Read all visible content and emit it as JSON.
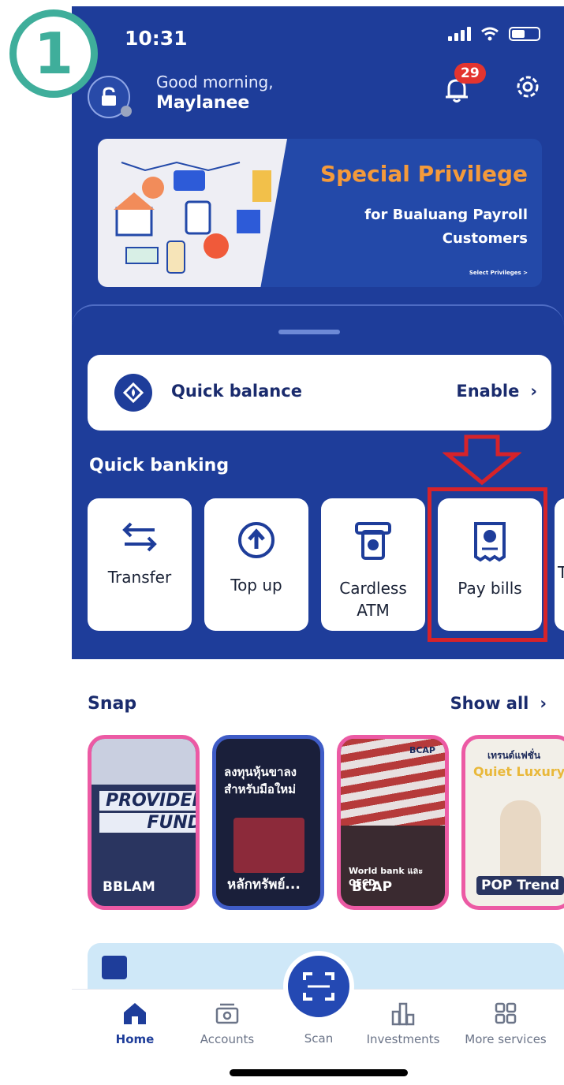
{
  "step": {
    "number": "1",
    "color": "#3fae9b"
  },
  "status_bar": {
    "time": "10:31"
  },
  "header": {
    "greeting": "Good morning,",
    "user_name": "Maylanee",
    "notification_count": "29",
    "lock_icon": "lock-icon",
    "bell_icon": "bell-icon",
    "gear_icon": "gear-icon"
  },
  "banner": {
    "title": "Special Privilege",
    "subtitle_line1": "for Bualuang Payroll",
    "subtitle_line2": "Customers",
    "link": "Select Privileges >"
  },
  "quick_balance": {
    "label": "Quick balance",
    "action": "Enable"
  },
  "quick_banking": {
    "title": "Quick banking",
    "tiles": [
      {
        "label": "Transfer",
        "icon": "transfer-icon"
      },
      {
        "label": "Top up",
        "icon": "top-up-icon"
      },
      {
        "label": "Cardless",
        "label2": "ATM",
        "icon": "atm-icon"
      },
      {
        "label": "Pay bills",
        "icon": "bill-icon"
      },
      {
        "label": "T",
        "icon": ""
      }
    ]
  },
  "snap": {
    "title": "Snap",
    "show_all": "Show all",
    "cards": [
      {
        "caption": "BBLAM",
        "headline": "PROVIDENT",
        "headline2": "FUND"
      },
      {
        "caption": "หลักทรัพย์...",
        "headline": "ลงทุนหุ้นขาลง",
        "headline2": "สำหรับมือใหม่"
      },
      {
        "caption": "BCAP",
        "headline": "BCAP",
        "headline2": "World bank และ OECD"
      },
      {
        "caption": "POP Trend",
        "headline": "เทรนด์แฟชั่น",
        "headline2": "Quiet Luxury"
      }
    ]
  },
  "nav": {
    "items": [
      {
        "label": "Home",
        "icon": "home-icon",
        "active": true
      },
      {
        "label": "Accounts",
        "icon": "accounts-icon"
      },
      {
        "label": "Scan",
        "icon": "scan-icon"
      },
      {
        "label": "Investments",
        "icon": "investments-icon"
      },
      {
        "label": "More services",
        "icon": "grid-icon"
      }
    ]
  },
  "colors": {
    "primary": "#1e3d9a",
    "accent_orange": "#f49a3b",
    "highlight_red": "#d6232a",
    "snap_pink": "#ec5aa4"
  }
}
